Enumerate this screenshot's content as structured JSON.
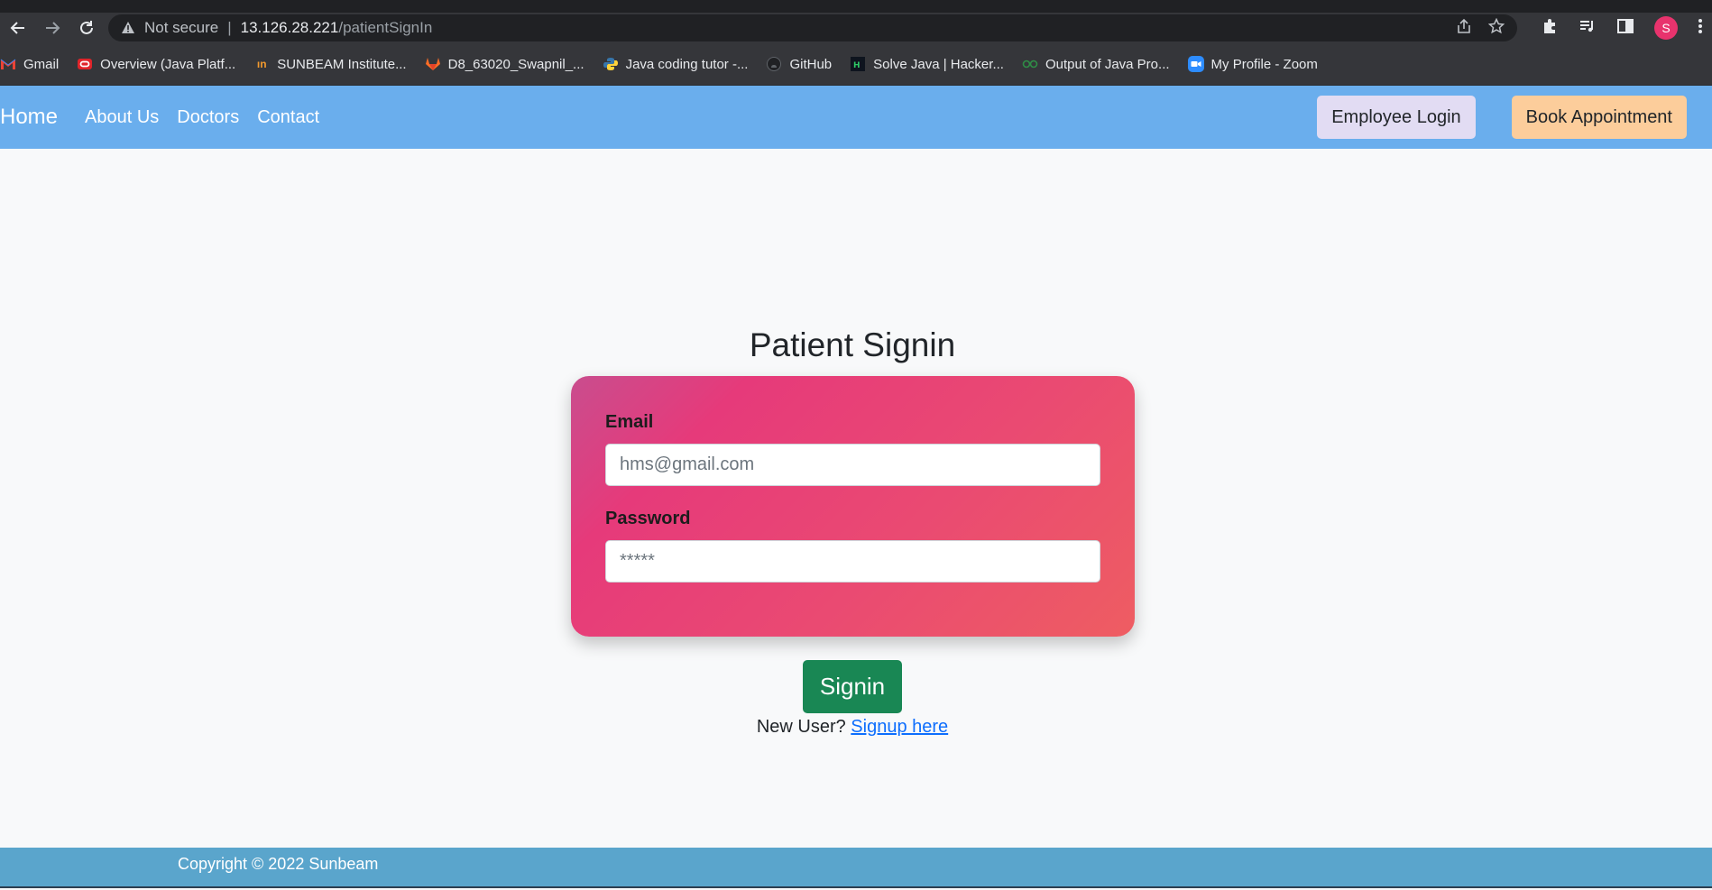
{
  "browser": {
    "security_label": "Not secure",
    "url_host": "13.126.28.221",
    "url_path": "/patientSignIn",
    "profile_initial": "S",
    "bookmarks": [
      {
        "label": "Gmail",
        "icon": "gmail-icon"
      },
      {
        "label": "Overview (Java Platf...",
        "icon": "oracle-icon"
      },
      {
        "label": "SUNBEAM Institute...",
        "icon": "sunbeam-icon"
      },
      {
        "label": "D8_63020_Swapnil_...",
        "icon": "gitlab-icon"
      },
      {
        "label": "Java coding tutor -...",
        "icon": "python-icon"
      },
      {
        "label": "GitHub",
        "icon": "github-icon"
      },
      {
        "label": "Solve Java | Hacker...",
        "icon": "hackerrank-icon"
      },
      {
        "label": "Output of Java Pro...",
        "icon": "geeksforgeeks-icon"
      },
      {
        "label": "My Profile - Zoom",
        "icon": "zoom-icon"
      }
    ]
  },
  "navbar": {
    "brand": "Home",
    "links": [
      "About Us",
      "Doctors",
      "Contact"
    ],
    "employee_login": "Employee Login",
    "book_appointment": "Book Appointment"
  },
  "main": {
    "title": "Patient Signin",
    "email_label": "Email",
    "email_placeholder": "hms@gmail.com",
    "password_label": "Password",
    "password_placeholder": "*****",
    "signin_button": "Signin",
    "new_user_text": "New User?",
    "signup_link": "Signup here"
  },
  "footer": {
    "copyright": "Copyright © 2022 Sunbeam"
  },
  "colors": {
    "navbar": "#6aaeed",
    "signin_button": "#198754",
    "card_gradient_start": "#c94d8e",
    "card_gradient_end": "#ee5d62",
    "footer": "#5aa5cc"
  }
}
